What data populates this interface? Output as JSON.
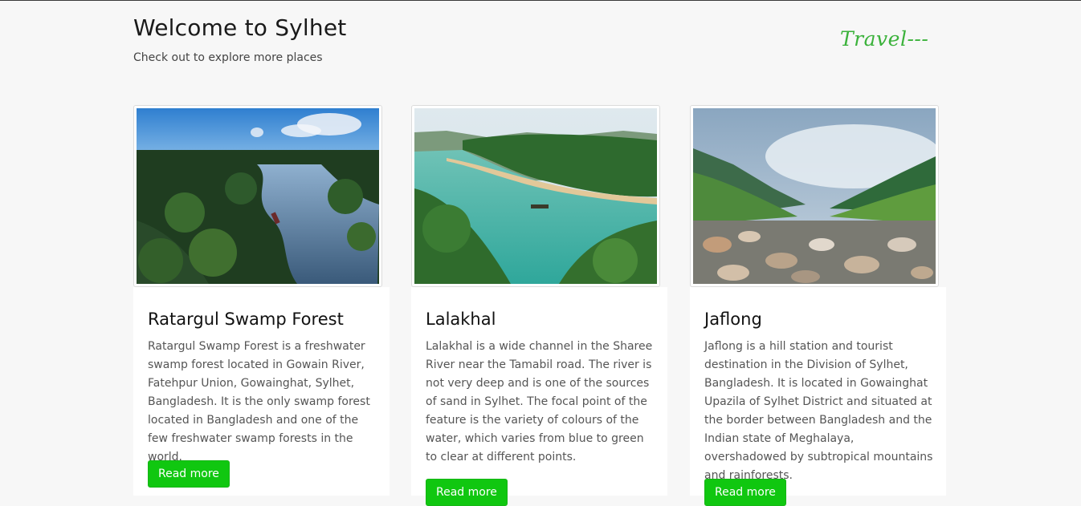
{
  "header": {
    "title": "Welcome to Sylhet",
    "subtitle": "Check out to explore more places",
    "brand": "Travel---"
  },
  "cards": [
    {
      "title": "Ratargul Swamp Forest",
      "description": "Ratargul Swamp Forest is a freshwater swamp forest located in Gowain River, Fatehpur Union, Gowainghat, Sylhet, Bangladesh. It is the only swamp forest located in Bangladesh and one of the few freshwater swamp forests in the world.",
      "button_label": "Read more"
    },
    {
      "title": "Lalakhal",
      "description": "Lalakhal is a wide channel in the Sharee River near the Tamabil road. The river is not very deep and is one of the sources of sand in Sylhet. The focal point of the feature is the variety of colours of the water, which varies from blue to green to clear at different points.",
      "button_label": "Read more"
    },
    {
      "title": "Jaflong",
      "description": "Jaflong is a hill station and tourist destination in the Division of Sylhet, Bangladesh. It is located in Gowainghat Upazila of Sylhet District and situated at the border between Bangladesh and the Indian state of Meghalaya, overshadowed by subtropical mountains and rainforests.",
      "button_label": "Read more"
    }
  ],
  "colors": {
    "accent_green": "#10c710",
    "brand_green": "#3bb23b",
    "page_background": "#f7f7f7"
  }
}
